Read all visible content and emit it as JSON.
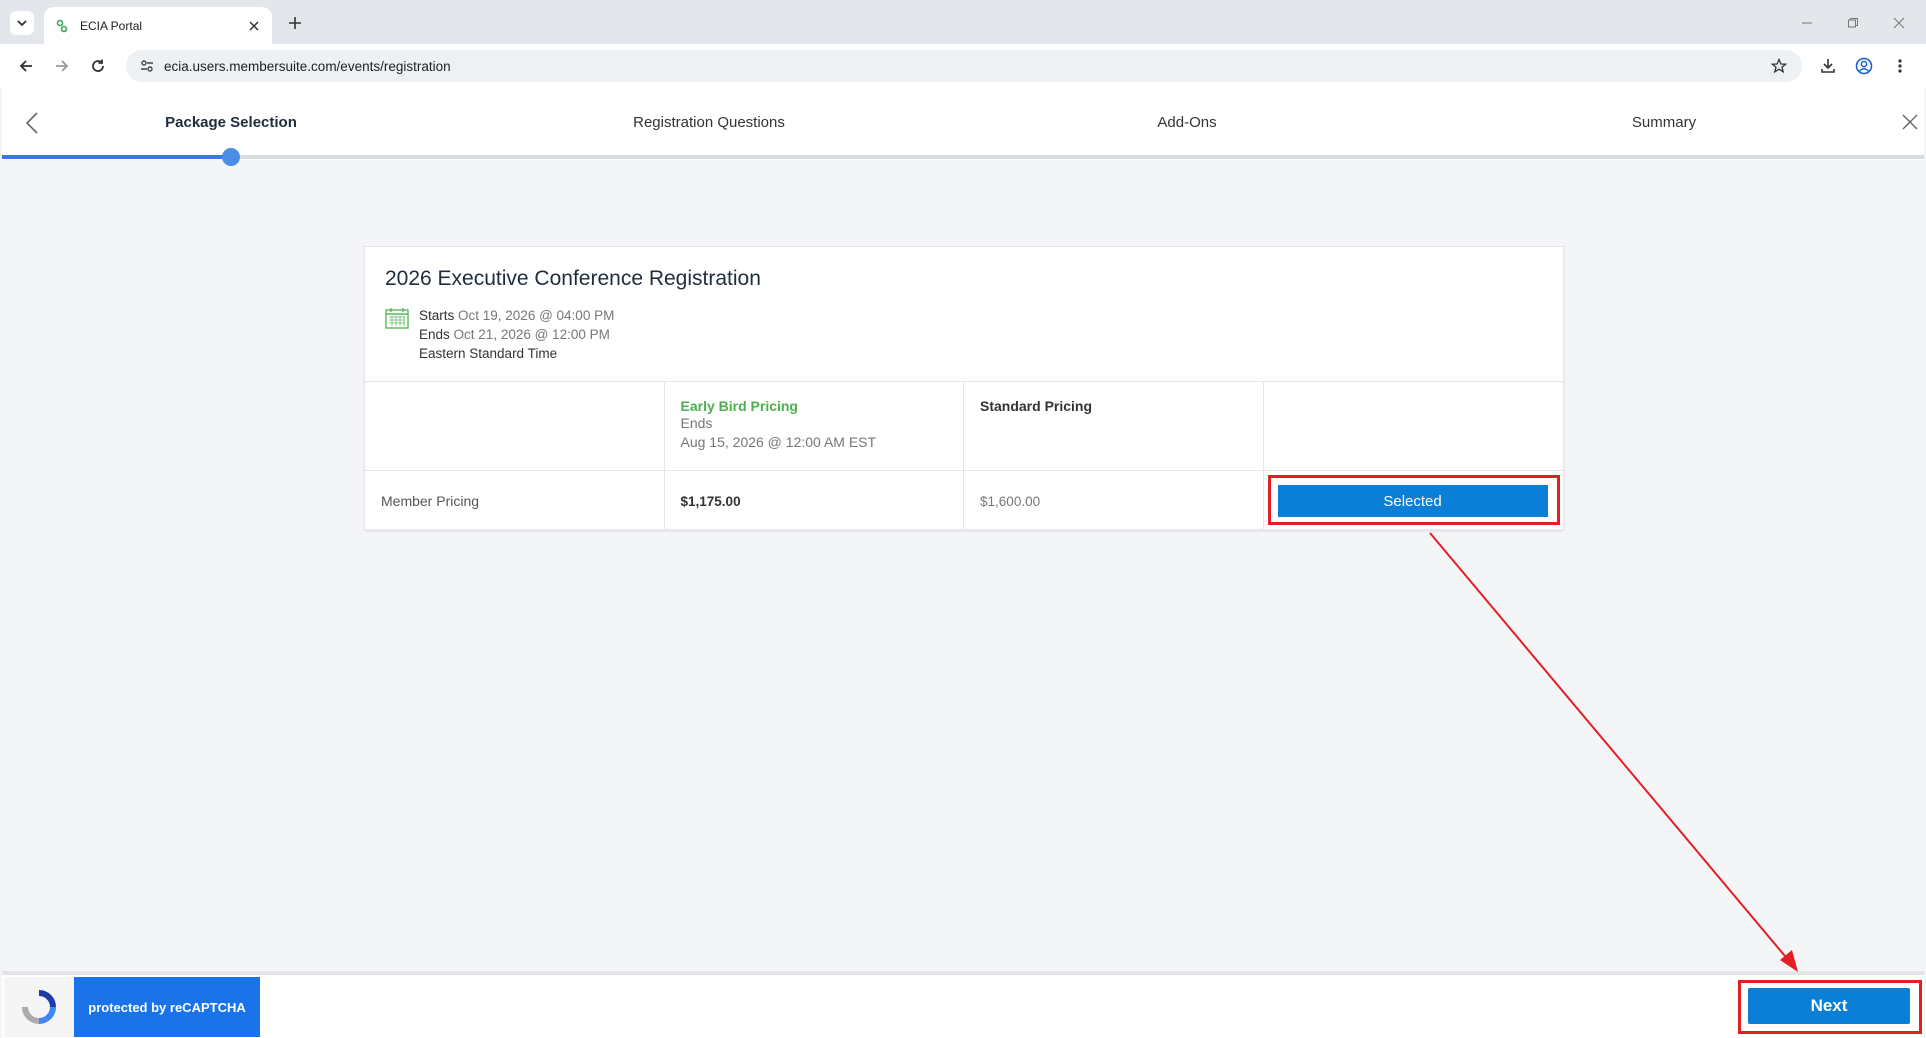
{
  "browser": {
    "tab_title": "ECIA Portal",
    "url": "ecia.users.membersuite.com/events/registration"
  },
  "steps": [
    {
      "label": "Package Selection",
      "active": true
    },
    {
      "label": "Registration Questions",
      "active": false
    },
    {
      "label": "Add-Ons",
      "active": false
    },
    {
      "label": "Summary",
      "active": false
    }
  ],
  "event": {
    "title": "2026 Executive Conference Registration",
    "starts_label": "Starts",
    "starts_value": "Oct 19, 2026 @ 04:00 PM",
    "ends_label": "Ends",
    "ends_value": "Oct 21, 2026 @ 12:00 PM",
    "timezone": "Eastern Standard Time"
  },
  "pricing": {
    "early_bird_title": "Early Bird Pricing",
    "early_bird_ends_label": "Ends",
    "early_bird_ends_value": "Aug 15, 2026 @ 12:00 AM EST",
    "standard_title": "Standard Pricing",
    "row_label": "Member Pricing",
    "early_bird_price": "$1,175.00",
    "standard_price": "$1,600.00",
    "select_label": "Selected"
  },
  "footer": {
    "recaptcha": "protected by reCAPTCHA",
    "next_label": "Next"
  },
  "colors": {
    "primary": "#0b7fd6",
    "early_bird": "#4caf50",
    "annotation": "#e31e24"
  }
}
